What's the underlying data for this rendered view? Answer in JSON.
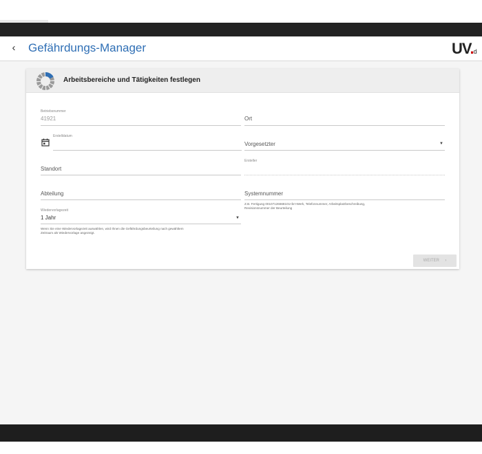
{
  "header": {
    "back_icon": "chevron-left-icon",
    "title": "Gefährdungs-Manager",
    "logo_main": "UV",
    "logo_dot": ".",
    "logo_suffix": "d"
  },
  "card": {
    "title": "Arbeitsbereiche und Tätigkeiten festlegen",
    "progress_icon": "progress-ring-icon",
    "progress_fraction": 0.17
  },
  "form": {
    "betriebsnummer": {
      "label": "Betriebsnummer",
      "value": "41921"
    },
    "ort": {
      "placeholder": "Ort"
    },
    "erstelldatum": {
      "label": "Erstelldatum",
      "value": "",
      "icon": "calendar-icon"
    },
    "vorgesetzter": {
      "placeholder": "Vorgesetzter"
    },
    "standort": {
      "placeholder": "Standort"
    },
    "ersteller": {
      "label": "Ersteller",
      "value": ""
    },
    "abteilung": {
      "placeholder": "Abteilung"
    },
    "systemnummer": {
      "placeholder": "Systemnummer",
      "hint_line1": "Z.B. Fertigung 00107126668101<br>Werk, Telefonnummer, Arbeitsplatzbeschreibung,",
      "hint_line2": "Revisionsnummer der Beurteilung"
    },
    "wiedervorlagezeit": {
      "label": "Wiedervorlagezeit",
      "value": "1 Jahr",
      "hint_line1": "Wenn Sie eine Wiedervorlagezeit auswählen, wird Ihnen die Gefährdungsbeurteilung nach gewähltem",
      "hint_line2": "Zeitraum als Wiedervorlage angezeigt."
    }
  },
  "buttons": {
    "weiter": "WEITER",
    "weiter_arrow": "›"
  },
  "colors": {
    "accent": "#2f6fb5",
    "top_bar": "#222222",
    "background": "#f5f5f5",
    "logo_dot": "#cc0000"
  }
}
